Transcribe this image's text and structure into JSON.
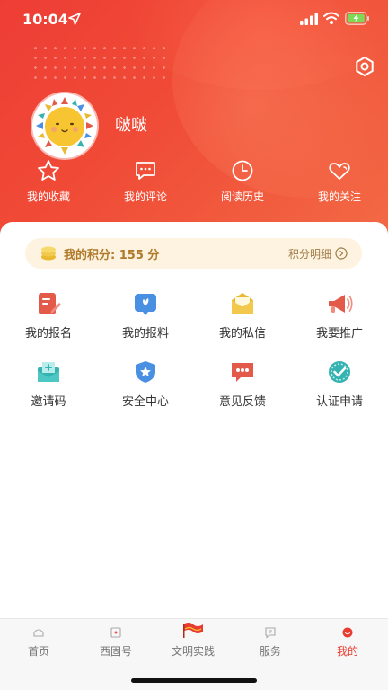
{
  "status_bar": {
    "time": "10:04"
  },
  "profile": {
    "username": "啵啵"
  },
  "quick_actions": [
    {
      "label": "我的收藏",
      "icon": "star-icon"
    },
    {
      "label": "我的评论",
      "icon": "comment-icon"
    },
    {
      "label": "阅读历史",
      "icon": "clock-icon"
    },
    {
      "label": "我的关注",
      "icon": "heart-icon"
    }
  ],
  "points": {
    "label": "我的积分: 155 分",
    "detail_label": "积分明细"
  },
  "services": [
    {
      "label": "我的报名",
      "icon": "signup-icon",
      "color": "#e45a4a"
    },
    {
      "label": "我的报料",
      "icon": "report-icon",
      "color": "#4a90e2"
    },
    {
      "label": "我的私信",
      "icon": "mail-icon",
      "color": "#e8b931"
    },
    {
      "label": "我要推广",
      "icon": "megaphone-icon",
      "color": "#e45a4a"
    },
    {
      "label": "邀请码",
      "icon": "invite-icon",
      "color": "#35b3b0"
    },
    {
      "label": "安全中心",
      "icon": "shield-icon",
      "color": "#4a90e2"
    },
    {
      "label": "意见反馈",
      "icon": "feedback-icon",
      "color": "#e45a4a"
    },
    {
      "label": "认证申请",
      "icon": "verify-icon",
      "color": "#35b3b0"
    }
  ],
  "tabs": [
    {
      "label": "首页",
      "icon": "home-icon"
    },
    {
      "label": "西固号",
      "icon": "channel-icon"
    },
    {
      "label": "文明实践",
      "icon": "flag-icon"
    },
    {
      "label": "服务",
      "icon": "service-icon"
    },
    {
      "label": "我的",
      "icon": "profile-icon",
      "active": true
    }
  ],
  "colors": {
    "primary": "#ee3d35",
    "active_tab": "#e83c30",
    "points_bg": "#fdf3e0"
  }
}
